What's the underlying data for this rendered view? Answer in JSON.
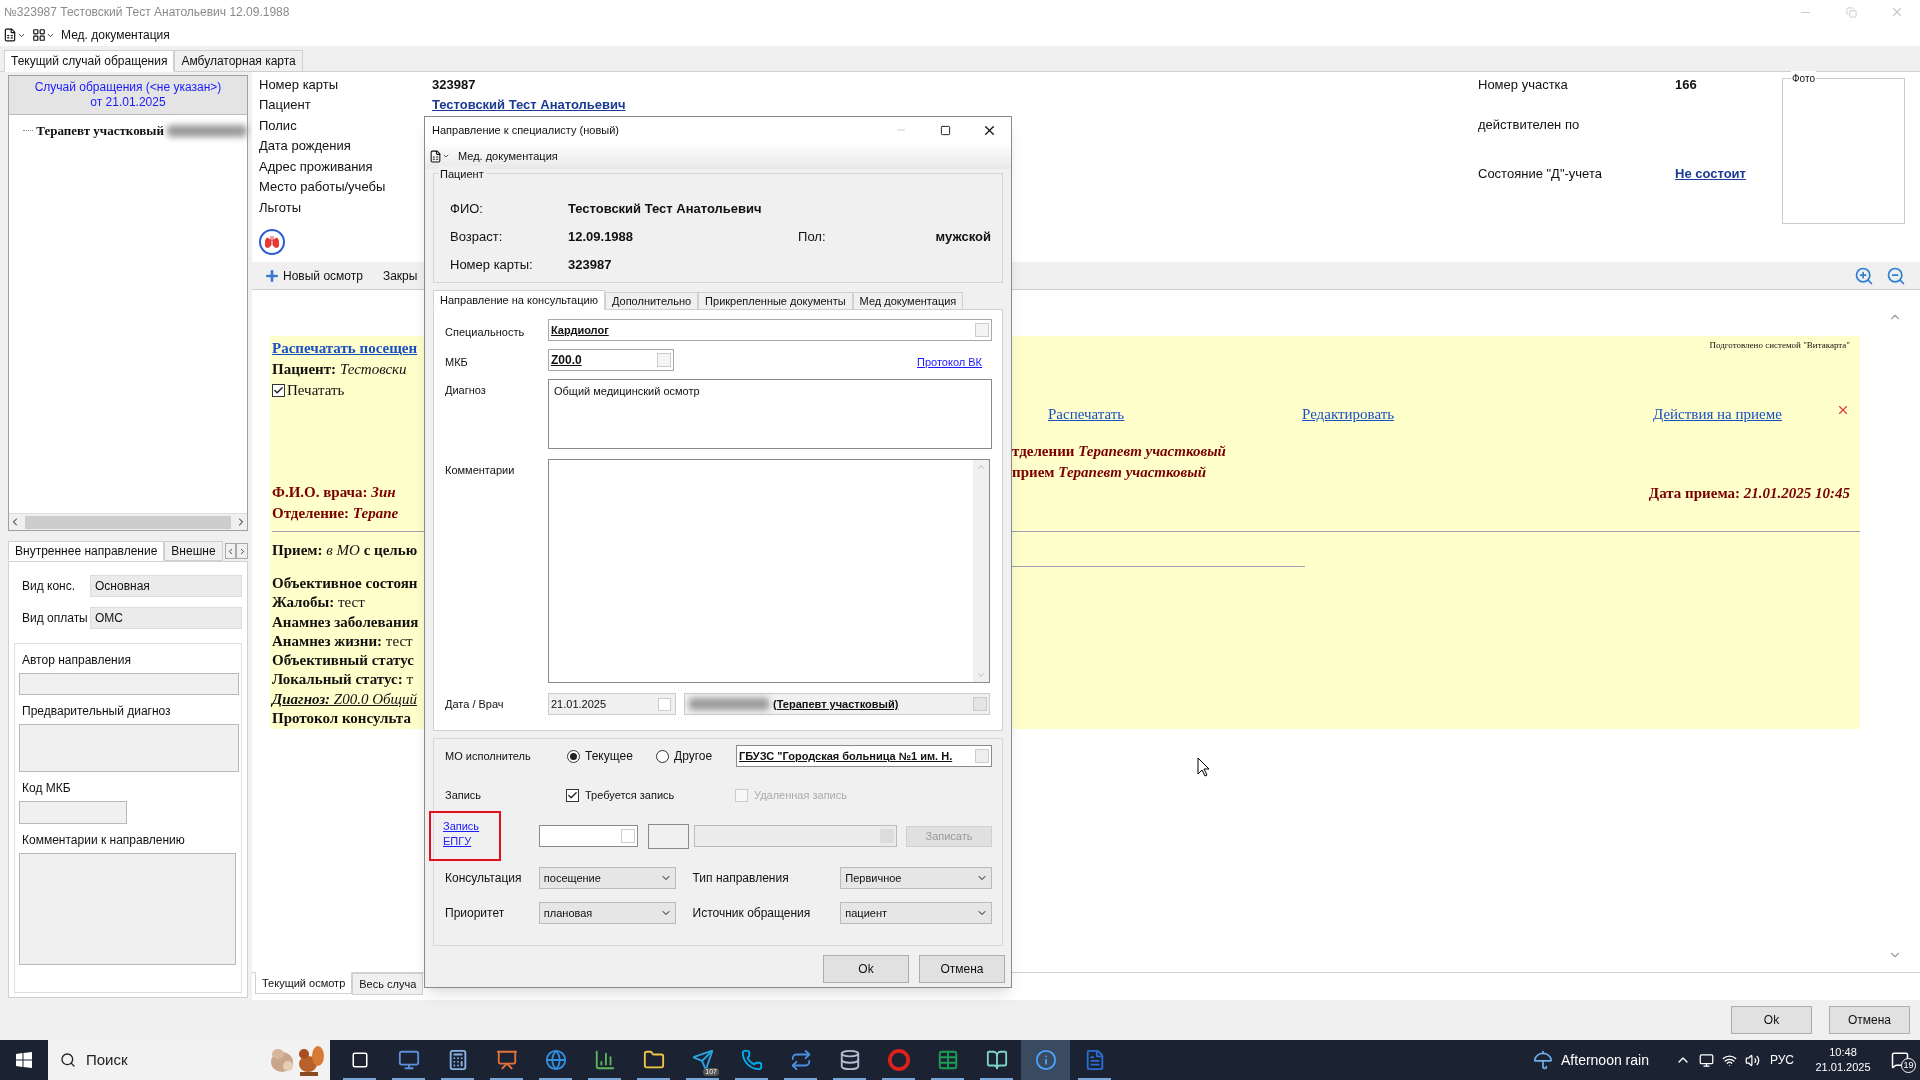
{
  "window": {
    "title": "№323987 Тестовский Тест Анатольевич 12.09.1988",
    "toolbar_label": "Мед. документация"
  },
  "tabs": [
    {
      "label": "Текущий случай обращения",
      "selected": true
    },
    {
      "label": "Амбулаторная карта",
      "selected": false
    }
  ],
  "case_panel": {
    "header": [
      "Случай обращения (<не указан>)",
      "от 21.01.2025"
    ],
    "tree": [
      {
        "label": "Терапевт участковый",
        "blurred": true
      }
    ]
  },
  "referral_panel": {
    "tabs": [
      {
        "label": "Внутреннее направление",
        "selected": true
      },
      {
        "label": "Внешне",
        "selected": false
      }
    ],
    "fields": [
      {
        "label": "Вид конс.",
        "value": "Основная"
      },
      {
        "label": "Вид оплаты",
        "value": "ОМС"
      }
    ],
    "sections": [
      {
        "label": "Автор направления",
        "kind": "line"
      },
      {
        "label": "Предварительный диагноз",
        "kind": "area"
      },
      {
        "label": "Код МКБ",
        "kind": "short"
      },
      {
        "label": "Комментарии к направлению",
        "kind": "tall"
      }
    ]
  },
  "patient_info": [
    {
      "label": "Номер карты",
      "value": "323987",
      "kind": "text"
    },
    {
      "label": "Пациент",
      "value": "Тестовский Тест Анатольевич",
      "kind": "link"
    },
    {
      "label": "Полис"
    },
    {
      "label": "Дата рождения"
    },
    {
      "label": "Адрес проживания"
    },
    {
      "label": "Место работы/учебы"
    },
    {
      "label": "Льготы"
    }
  ],
  "district_info": [
    {
      "label": "Номер участка",
      "value": "166",
      "kind": "text"
    },
    {
      "label": "действителен по"
    },
    {
      "label": "Состояние \"Д\"-учета",
      "value": "Не состоит",
      "kind": "link"
    }
  ],
  "photo": {
    "label": "Фото"
  },
  "exam_toolbar": [
    "Новый осмотр",
    "Закры"
  ],
  "document": {
    "print_link": "Распечатать посещен",
    "patient": {
      "label": "Пациент:",
      "value": "Тестовски"
    },
    "print_checkbox": {
      "label": "Печатать",
      "checked": true
    },
    "prepared_by": "Подготовлено системой \"Витакарта\"",
    "actions": [
      "Распечатать",
      "Редактировать",
      "Действия на приеме"
    ],
    "department_lines": [
      {
        "label": "тделении",
        "value": "Терапевт участковый"
      },
      {
        "label": "прием",
        "value": "Терапевт участковый"
      }
    ],
    "doctor": {
      "label": "Ф.И.О. врача:",
      "value": "Зин"
    },
    "department": {
      "label": "Отделение:",
      "value": "Терапе"
    },
    "visit_date": {
      "label": "Дата приема:",
      "value": "21.01.2025 10:45"
    },
    "visit": "**Прием:** *в МО* **с целью**",
    "findings": [
      {
        "label": "Объективное состоян",
        "kind": "heading"
      },
      {
        "label": "Жалобы:",
        "value": "тест",
        "kind": "field"
      },
      {
        "label": "Анамнез заболевания",
        "kind": "heading"
      },
      {
        "label": "Анамнез жизни:",
        "value": "тест",
        "kind": "field"
      },
      {
        "label": "Объективный статус",
        "kind": "heading"
      },
      {
        "label": "Локальный статус:",
        "value": "т",
        "kind": "field"
      },
      {
        "label": "Диагноз:",
        "value": "Z00.0 Общий",
        "kind": "diagnosis"
      },
      {
        "label": "Протокол консульта",
        "kind": "heading"
      }
    ]
  },
  "bottom_tabs": [
    {
      "label": "Текущий осмотр",
      "selected": true
    },
    {
      "label": "Весь случа",
      "selected": false
    }
  ],
  "footer_buttons": [
    "Ok",
    "Отмена"
  ],
  "dialog": {
    "title": "Направление к специалисту (новый)",
    "toolbar_label": "Мед. документация",
    "patient": {
      "title": "Пациент",
      "name_label": "ФИО:",
      "name": "Тестовский Тест Анатольевич",
      "age_label": "Возраст:",
      "age": "12.09.1988",
      "sex_label": "Пол:",
      "sex": "мужской",
      "card_label": "Номер карты:",
      "card": "323987"
    },
    "tabs": [
      {
        "label": "Направление на консультацию",
        "selected": true
      },
      {
        "label": "Дополнительно",
        "selected": false
      },
      {
        "label": "Прикрепленные документы",
        "selected": false
      },
      {
        "label": "Мед документация",
        "selected": false
      }
    ],
    "specialty": {
      "label": "Специальность",
      "value": "Кардиолог"
    },
    "mkb": {
      "label": "МКБ",
      "value": "Z00.0",
      "link": "Протокол ВК"
    },
    "diagnosis": {
      "label": "Диагноз",
      "value": "Общий медицинский осмотр"
    },
    "comments": {
      "label": "Комментарии"
    },
    "date_doctor": {
      "label": "Дата / Врач",
      "date": "21.01.2025",
      "doctor": "(Терапевт участковый)",
      "blurred": true
    },
    "executor": {
      "label": "МО исполнитель",
      "options": [
        {
          "label": "Текущее",
          "selected": true
        },
        {
          "label": "Другое",
          "selected": false
        }
      ],
      "value": "ГБУЗС \"Городская больница №1 им. Н."
    },
    "record": {
      "label": "Запись",
      "checkboxes": [
        {
          "label": "Требуется запись",
          "checked": true,
          "disabled": false
        },
        {
          "label": "Удаленная запись",
          "checked": false,
          "disabled": true
        }
      ]
    },
    "epgu_link": "Запись ЕПГУ",
    "record_button": {
      "label": "Записать",
      "disabled": true
    },
    "selects": [
      {
        "label": "Консультация",
        "value": "посещение"
      },
      {
        "label": "Тип направления",
        "value": "Первичное"
      },
      {
        "label": "Приоритет",
        "value": "плановая"
      },
      {
        "label": "Источник обращения",
        "value": "пациент"
      }
    ],
    "buttons": [
      "Ok",
      "Отмена"
    ]
  },
  "taskbar": {
    "search_placeholder": "Поиск",
    "app_badge": "107",
    "weather": "Afternoon rain",
    "language": "РУС",
    "time": "10:48",
    "date": "21.01.2025",
    "notifications": "19"
  }
}
